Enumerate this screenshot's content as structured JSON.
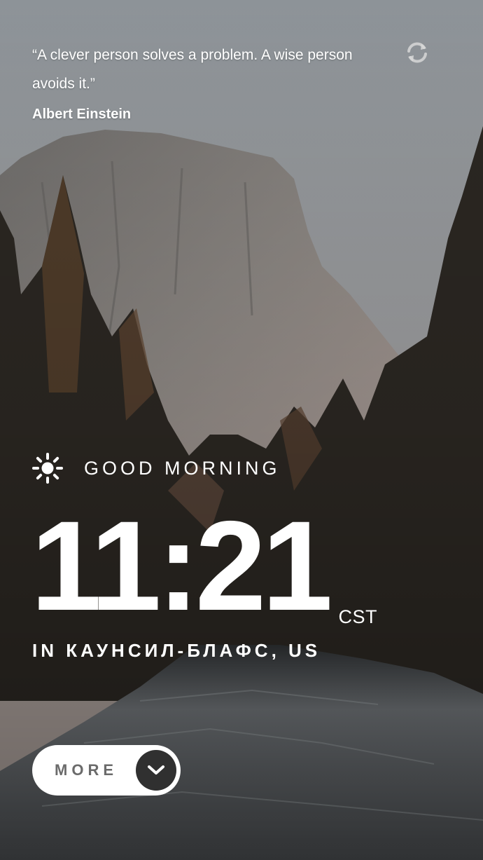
{
  "quote": {
    "text": "“A clever person solves a problem. A wise person avoids it.”",
    "author": "Albert Einstein",
    "refresh_icon": "refresh-icon"
  },
  "greeting": {
    "icon": "sun-icon",
    "text": "GOOD MORNING"
  },
  "clock": {
    "time": "11:21",
    "timezone": "CST"
  },
  "location": {
    "text": "IN КАУНСИЛ-БЛАФС, US"
  },
  "more_button": {
    "label": "MORE",
    "icon": "chevron-down-icon"
  },
  "colors": {
    "button_bg": "#ffffff",
    "button_label": "#6b6b6b",
    "chevron_circle": "#303030",
    "text": "#ffffff"
  }
}
